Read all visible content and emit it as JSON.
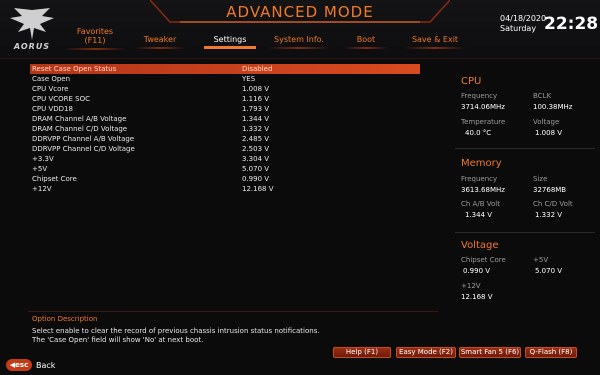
{
  "header": {
    "mode_title": "ADVANCED MODE",
    "logo_text": "AORUS",
    "date": "04/18/2020",
    "day": "Saturday",
    "time": "22:28",
    "tabs": [
      {
        "line1": "Favorites",
        "line2": "(F11)"
      },
      {
        "line1": "Tweaker"
      },
      {
        "line1": "Settings"
      },
      {
        "line1": "System Info."
      },
      {
        "line1": "Boot"
      },
      {
        "line1": "Save & Exit"
      }
    ]
  },
  "list": [
    {
      "label": "Reset Case Open Status",
      "value": "Disabled"
    },
    {
      "label": "Case Open",
      "value": "YES"
    },
    {
      "label": "CPU Vcore",
      "value": "1.008 V"
    },
    {
      "label": "CPU VCORE SOC",
      "value": "1.116 V"
    },
    {
      "label": "CPU VDD18",
      "value": "1.793 V"
    },
    {
      "label": "DRAM Channel A/B Voltage",
      "value": "1.344 V"
    },
    {
      "label": "DRAM Channel C/D Voltage",
      "value": "1.332 V"
    },
    {
      "label": "DDRVPP Channel A/B Voltage",
      "value": "2.485 V"
    },
    {
      "label": "DDRVPP Channel C/D Voltage",
      "value": "2.503 V"
    },
    {
      "label": "+3.3V",
      "value": "3.304 V"
    },
    {
      "label": "+5V",
      "value": "5.070 V"
    },
    {
      "label": "Chipset Core",
      "value": "0.990 V"
    },
    {
      "label": "+12V",
      "value": "12.168 V"
    }
  ],
  "cpu": {
    "title": "CPU",
    "freq_label": "Frequency",
    "freq": "3714.06MHz",
    "bclk_label": "BCLK",
    "bclk": "100.38MHz",
    "temp_label": "Temperature",
    "temp": "40.0 °C",
    "volt_label": "Voltage",
    "volt": "1.008 V"
  },
  "memory": {
    "title": "Memory",
    "freq_label": "Frequency",
    "freq": "3613.68MHz",
    "size_label": "Size",
    "size": "32768MB",
    "chab_label": "Ch A/B Volt",
    "chab": "1.344 V",
    "chcd_label": "Ch C/D Volt",
    "chcd": "1.332 V"
  },
  "voltage": {
    "title": "Voltage",
    "chipset_label": "Chipset Core",
    "chipset": "0.990 V",
    "v5_label": "+5V",
    "v5": "5.070 V",
    "v12_label": "+12V",
    "v12": "12.168 V"
  },
  "option": {
    "title": "Option Description",
    "text": "Select enable to clear the record of previous chassis intrusion status notifications. The 'Case Open' field will show 'No' at next boot."
  },
  "footer": {
    "help": "Help (F1)",
    "easy": "Easy Mode (F2)",
    "smartfan": "Smart Fan 5 (F6)",
    "qflash": "Q-Flash (F8)",
    "esc": "esc",
    "back": "Back"
  }
}
